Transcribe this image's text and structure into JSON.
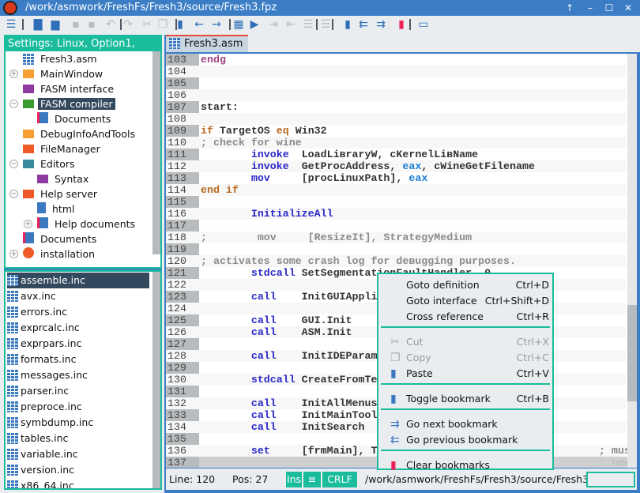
{
  "window": {
    "title": "/work/asmwork/FreshFs/Fresh3/source/Fresh3.fpz",
    "buttons": [
      "↑",
      "–",
      "☐",
      "✕"
    ]
  },
  "toolbar": {
    "icons": [
      "menu-icon",
      "new-file-icon",
      "open-icon",
      "save-icon",
      "save-all-icon",
      "undo-icon",
      "redo-icon",
      "cut-icon",
      "copy-icon",
      "paste-icon",
      "back-icon",
      "forward-icon",
      "compile-icon",
      "run-icon",
      "indent-icon",
      "outdent-icon",
      "comment-icon",
      "uncomment-icon",
      "toggle-bookmark-icon",
      "prev-bookmark-icon",
      "next-bookmark-icon",
      "clear-bookmarks-icon",
      "terminal-icon"
    ]
  },
  "project": {
    "header": "Settings: Linux, Option1,",
    "items": [
      {
        "label": "Fresh3.asm",
        "icon": "asm-file",
        "level": 0,
        "exp": ""
      },
      {
        "label": "MainWindow",
        "icon": "folder",
        "color": "#f5a030",
        "level": 0,
        "exp": "+"
      },
      {
        "label": "FASM interface",
        "icon": "folder",
        "color": "#8e3aa0",
        "level": 0,
        "exp": ""
      },
      {
        "label": "FASM compiler",
        "icon": "folder",
        "color": "#3a9a30",
        "level": 0,
        "exp": "-",
        "selected": true
      },
      {
        "label": "Documents",
        "icon": "doc",
        "level": 1,
        "exp": ""
      },
      {
        "label": "DebugInfoAndTools",
        "icon": "folder",
        "color": "#f5a030",
        "level": 0,
        "exp": ""
      },
      {
        "label": "FileManager",
        "icon": "folder",
        "color": "#f05a28",
        "level": 0,
        "exp": ""
      },
      {
        "label": "Editors",
        "icon": "folder",
        "color": "#3a8aa0",
        "level": 0,
        "exp": "-"
      },
      {
        "label": "Syntax",
        "icon": "folder",
        "color": "#8e3aa0",
        "level": 1,
        "exp": ""
      },
      {
        "label": "Help server",
        "icon": "folder",
        "color": "#f05a28",
        "level": 0,
        "exp": "-"
      },
      {
        "label": "html",
        "icon": "page",
        "level": 1,
        "exp": ""
      },
      {
        "label": "Help documents",
        "icon": "doc",
        "level": 1,
        "exp": "+"
      },
      {
        "label": "Documents",
        "icon": "doc",
        "level": 0,
        "exp": ""
      },
      {
        "label": "installation",
        "icon": "pacman",
        "level": 0,
        "exp": "+"
      }
    ]
  },
  "files": [
    "assemble.inc",
    "avx.inc",
    "errors.inc",
    "exprcalc.inc",
    "exprpars.inc",
    "formats.inc",
    "messages.inc",
    "parser.inc",
    "preproce.inc",
    "symbdump.inc",
    "tables.inc",
    "variable.inc",
    "version.inc",
    "x86_64.inc"
  ],
  "editor": {
    "tab": "Fresh3.asm",
    "lines": [
      {
        "n": "103",
        "t": [
          [
            "dr",
            "endg"
          ]
        ]
      },
      {
        "n": "104",
        "t": []
      },
      {
        "n": "105",
        "t": []
      },
      {
        "n": "106",
        "t": []
      },
      {
        "n": "107",
        "t": [
          [
            "",
            "start:"
          ]
        ]
      },
      {
        "n": "108",
        "t": []
      },
      {
        "n": "109",
        "t": [
          [
            "cd",
            "if "
          ],
          [
            "",
            "TargetOS "
          ],
          [
            "cd",
            "eq "
          ],
          [
            "",
            "Win32"
          ]
        ]
      },
      {
        "n": "110",
        "t": [
          [
            "cm",
            "; check for wine"
          ]
        ]
      },
      {
        "n": "111",
        "t": [
          [
            "",
            "        "
          ],
          [
            "kw",
            "invoke"
          ],
          [
            "",
            "  LoadLiвraryW, cKernelLiвName"
          ]
        ]
      },
      {
        "n": "112",
        "t": [
          [
            "",
            "        "
          ],
          [
            "kw",
            "invoke"
          ],
          [
            "",
            "  GetProcAddress, "
          ],
          [
            "rg",
            "eax"
          ],
          [
            "",
            ", cWineGetFilename"
          ]
        ]
      },
      {
        "n": "113",
        "t": [
          [
            "",
            "        "
          ],
          [
            "kw",
            "mov"
          ],
          [
            "",
            "     [procLinuxPath], "
          ],
          [
            "rg",
            "eax"
          ]
        ]
      },
      {
        "n": "114",
        "t": [
          [
            "cd",
            "end if"
          ]
        ]
      },
      {
        "n": "115",
        "t": []
      },
      {
        "n": "116",
        "t": [
          [
            "",
            "        "
          ],
          [
            "kw",
            "InitializeAll"
          ]
        ]
      },
      {
        "n": "117",
        "t": []
      },
      {
        "n": "118",
        "t": [
          [
            "cm",
            ";        mov     [ResizeIt], StrategyMedium"
          ]
        ]
      },
      {
        "n": "119",
        "t": []
      },
      {
        "n": "120",
        "t": [
          [
            "cm",
            "; activates some crash log for deвugging purposes."
          ]
        ]
      },
      {
        "n": "121",
        "t": [
          [
            "",
            "        "
          ],
          [
            "kw",
            "stdcall"
          ],
          [
            "",
            " SetSegmentationFaultHandler, 0"
          ]
        ]
      },
      {
        "n": "122",
        "t": []
      },
      {
        "n": "123",
        "t": [
          [
            "",
            "        "
          ],
          [
            "kw",
            "call"
          ],
          [
            "",
            "    InitGUIAppli"
          ]
        ]
      },
      {
        "n": "124",
        "t": []
      },
      {
        "n": "125",
        "t": [
          [
            "",
            "        "
          ],
          [
            "kw",
            "call"
          ],
          [
            "",
            "    GUI.Init"
          ]
        ]
      },
      {
        "n": "126",
        "t": [
          [
            "",
            "        "
          ],
          [
            "kw",
            "call"
          ],
          [
            "",
            "    ASM.Init"
          ]
        ]
      },
      {
        "n": "127",
        "t": []
      },
      {
        "n": "128",
        "t": [
          [
            "",
            "        "
          ],
          [
            "kw",
            "call"
          ],
          [
            "",
            "    InitIDEParam"
          ]
        ]
      },
      {
        "n": "129",
        "t": []
      },
      {
        "n": "130",
        "t": [
          [
            "",
            "        "
          ],
          [
            "kw",
            "stdcall"
          ],
          [
            "",
            " CreateFromTe"
          ]
        ]
      },
      {
        "n": "131",
        "t": []
      },
      {
        "n": "132",
        "t": [
          [
            "",
            "        "
          ],
          [
            "kw",
            "call"
          ],
          [
            "",
            "    InitAllMenus"
          ]
        ]
      },
      {
        "n": "133",
        "t": [
          [
            "",
            "        "
          ],
          [
            "kw",
            "call"
          ],
          [
            "",
            "    InitMainTool"
          ]
        ]
      },
      {
        "n": "134",
        "t": [
          [
            "",
            "        "
          ],
          [
            "kw",
            "call"
          ],
          [
            "",
            "    InitSearch"
          ]
        ]
      },
      {
        "n": "135",
        "t": []
      },
      {
        "n": "136",
        "t": [
          [
            "",
            "        "
          ],
          [
            "kw",
            "set"
          ],
          [
            "",
            "     [frmMain], T"
          ]
        ],
        "r": "; mus"
      },
      {
        "n": "137",
        "t": [],
        "r": ": nee"
      }
    ]
  },
  "status": {
    "line": "Line: 120",
    "pos": "Pos: 27",
    "ins": "Ins",
    "eol": "CRLF",
    "path": "/work/asmwork/FreshFs/Fresh3/source/Fresh3"
  },
  "menu": {
    "items": [
      {
        "label": "Goto definition",
        "shortcut": "Ctrl+D"
      },
      {
        "label": "Goto interface",
        "shortcut": "Ctrl+Shift+D"
      },
      {
        "label": "Cross reference",
        "shortcut": "Ctrl+R"
      },
      {
        "sep": true
      },
      {
        "label": "Cut",
        "shortcut": "Ctrl+X",
        "icon": "scissors-icon",
        "disabled": true
      },
      {
        "label": "Copy",
        "shortcut": "Ctrl+C",
        "icon": "copy-icon",
        "disabled": true
      },
      {
        "label": "Paste",
        "shortcut": "Ctrl+V",
        "icon": "paste-icon"
      },
      {
        "sep": true
      },
      {
        "label": "Toggle bookmark",
        "shortcut": "Ctrl+B",
        "icon": "bookmark-icon"
      },
      {
        "sep": true
      },
      {
        "label": "Go next bookmark",
        "shortcut": "",
        "icon": "next-bookmark-icon"
      },
      {
        "label": "Go previous bookmark",
        "shortcut": "",
        "icon": "prev-bookmark-icon"
      },
      {
        "sep": true
      },
      {
        "label": "Clear bookmarks",
        "shortcut": "",
        "icon": "clear-bookmarks-icon"
      }
    ]
  },
  "colors": {
    "accent": "#1abc9c",
    "titlebar": "#3c7ec6",
    "selection": "#34495e"
  }
}
